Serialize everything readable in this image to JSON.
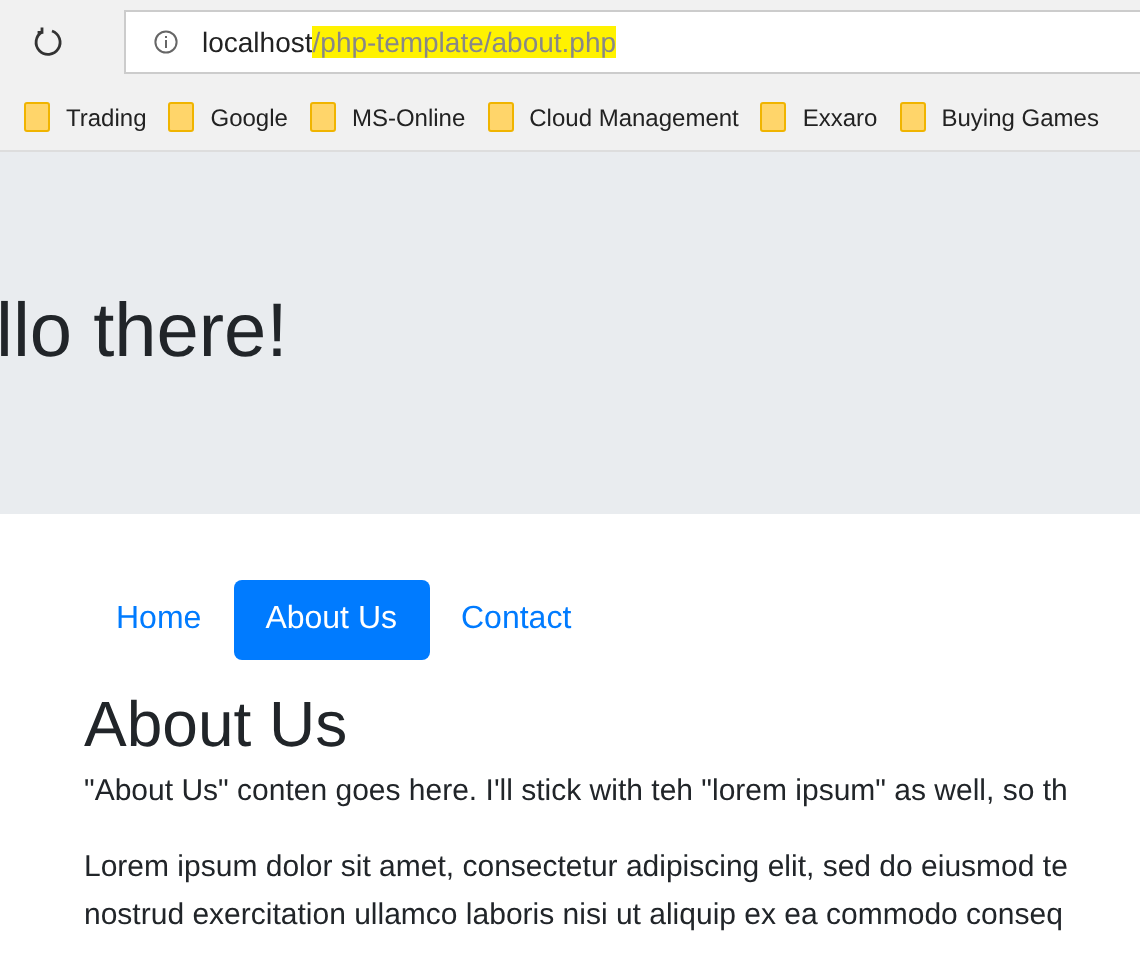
{
  "address_bar": {
    "host": "localhost",
    "path": "/php-template/about.php"
  },
  "bookmarks": [
    "Trading",
    "Google",
    "MS-Online",
    "Cloud Management",
    "Exxaro",
    "Buying Games"
  ],
  "jumbotron": {
    "title": "llo there!"
  },
  "nav": [
    {
      "label": "Home",
      "selected": false
    },
    {
      "label": "About Us",
      "selected": true
    },
    {
      "label": "Contact",
      "selected": false
    }
  ],
  "heading": "About Us",
  "paragraphs": [
    [
      "\"About Us\" conten goes here. I'll stick with teh \"lorem ipsum\" as well, so th"
    ],
    [
      "Lorem ipsum dolor sit amet, consectetur adipiscing elit, sed do eiusmod te",
      "nostrud exercitation ullamco laboris nisi ut aliquip ex ea commodo conseq"
    ]
  ]
}
